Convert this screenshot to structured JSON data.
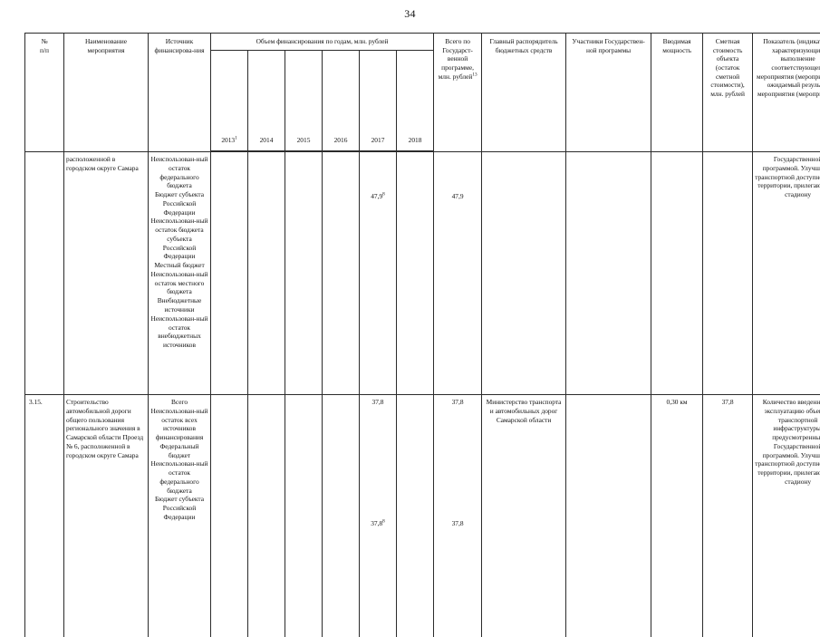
{
  "page_number": "34",
  "table": {
    "headers": {
      "no": "№\nп/п",
      "no_line1": "№",
      "no_line2": "п/п",
      "measure_name": "Наименование мероприятия",
      "funding_source": "Источник финансирова-ния",
      "funding_volume_group": "Объем финансирования по годам, млн. рублей",
      "years": [
        "2013",
        "2014",
        "2015",
        "2016",
        "2017",
        "2018"
      ],
      "year_2013_sup": "1",
      "total_program": "Всего по Государст-венной программе, млн. рублей",
      "total_program_sup": "13",
      "main_manager": "Главный распорядитель бюджетных средств",
      "participants": "Участники Государствен-ной программы",
      "capacity": "Вводимая мощность",
      "estimated_cost": "Сметная стоимость объекта (остаток сметной стоимости), млн. рублей",
      "indicator": "Показатель (индикатор), характеризующий выполнение соответствующего мероприятия (мероприятий), ожидаемый результат мероприятия (мероприятий)"
    },
    "rows": [
      {
        "no": "",
        "name": "расположенной в городском округе Самара",
        "sources": [
          "Неиспользован-ный остаток федерального бюджета",
          "Бюджет субъекта Российской Федерации",
          "Неиспользован-ный остаток бюджета субъекта Российской Федерации",
          "Местный бюджет",
          "Неиспользован-ный остаток местного бюджета",
          "Внебюджетные источники",
          "Неиспользован-ный остаток внебюджетных источников"
        ],
        "y2013": "",
        "y2014": "",
        "y2015": "",
        "y2016": "",
        "y2017": "47,9",
        "y2017_sup": "8",
        "y2018": "",
        "total": "47,9",
        "main_manager": "",
        "participants": "",
        "capacity": "",
        "estimated_cost": "",
        "indicator": "Государственной программой. Улучшение транспортной доступности на территории, прилегающей к стадиону"
      },
      {
        "no": "3.15.",
        "name": "Строительство автомобильной дороги общего пользования регионального значения в Самарской области Проезд № 6, расположенной в городском округе Самара",
        "sources": [
          "Всего",
          "Неиспользован-ный остаток всех источников финансирования",
          "Федеральный бюджет",
          "Неиспользован-ный остаток федерального бюджета",
          "Бюджет субъекта Российской Федерации"
        ],
        "y2017_first": "37,8",
        "total_first": "37,8",
        "y2017_second": "37,8",
        "y2017_second_sup": "8",
        "total_second": "37,8",
        "main_manager": "Министерство транспорта и автомобильных дорог Самарской области",
        "participants": "",
        "capacity": "0,30 км",
        "estimated_cost": "37,8",
        "indicator": "Количество введенных в эксплуатацию объектов транспортной инфраструктуры, предусмотренных Государственной программой. Улучшение транспортной доступности на территории, прилегающей к стадиону"
      }
    ]
  }
}
